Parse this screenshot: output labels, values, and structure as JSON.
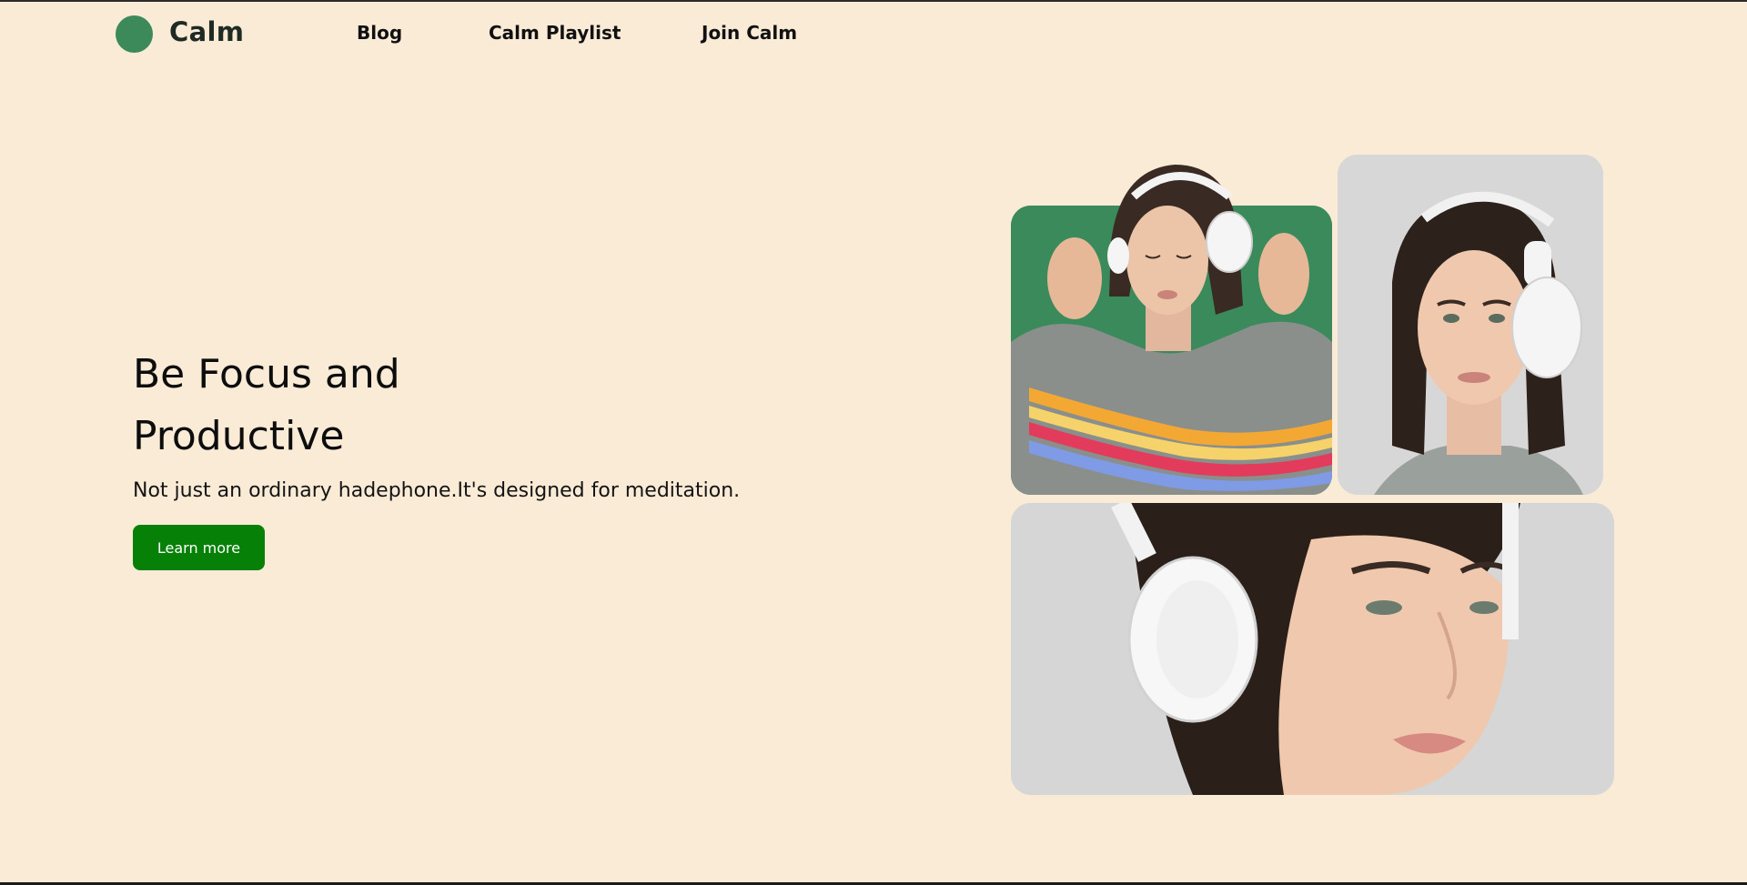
{
  "brand": {
    "name": "Calm",
    "color": "#3c8a5a"
  },
  "nav": {
    "links": [
      "Blog",
      "Calm Playlist",
      "Join Calm"
    ]
  },
  "hero": {
    "title_line1": "Be Focus and",
    "title_line2": "Productive",
    "subtitle": "Not just an ordinary hadephone.It's designed for meditation.",
    "cta_label": "Learn more",
    "cta_color": "#068006"
  },
  "gallery": {
    "images": [
      "woman-with-headphones-green-background",
      "woman-with-headphones-gray-background-portrait",
      "woman-with-headphones-closeup"
    ]
  },
  "colors": {
    "background": "#faebd7",
    "card_green": "#3b8a5b",
    "card_gray": "#d7d7d7"
  }
}
